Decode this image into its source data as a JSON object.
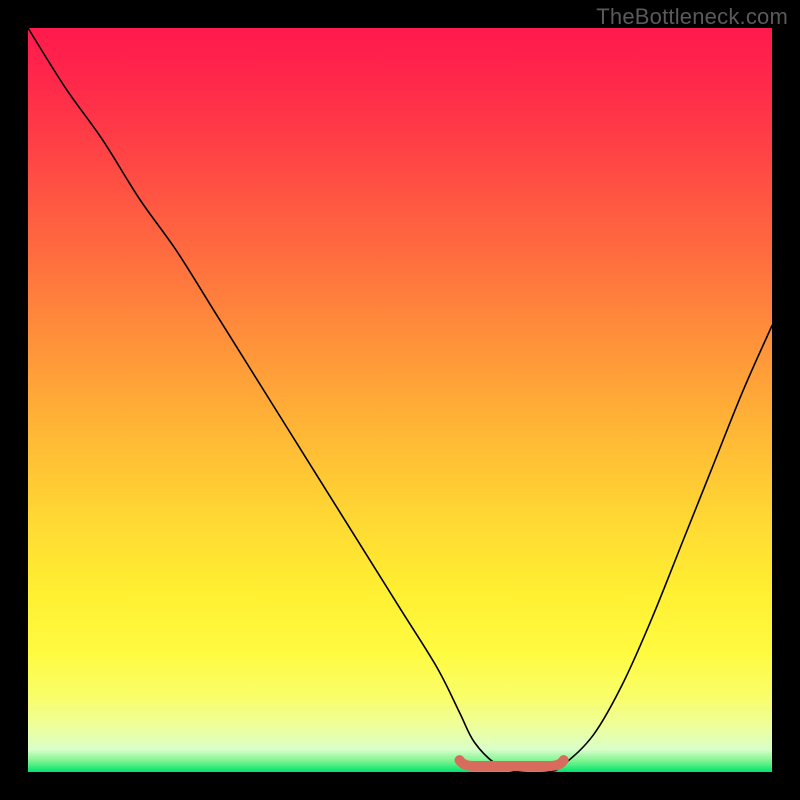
{
  "watermark": "TheBottleneck.com",
  "chart_data": {
    "type": "line",
    "title": "",
    "xlabel": "",
    "ylabel": "",
    "xlim": [
      0,
      100
    ],
    "ylim": [
      0,
      100
    ],
    "grid": false,
    "legend": false,
    "series": [
      {
        "name": "bottleneck-curve",
        "x": [
          0,
          5,
          10,
          15,
          20,
          25,
          30,
          35,
          40,
          45,
          50,
          55,
          58,
          60,
          63,
          66,
          70,
          72,
          76,
          80,
          84,
          88,
          92,
          96,
          100
        ],
        "y": [
          100,
          92,
          85,
          77,
          70,
          62,
          54,
          46,
          38,
          30,
          22,
          14,
          8,
          4,
          1,
          0,
          0,
          1,
          5,
          12,
          21,
          31,
          41,
          51,
          60
        ]
      }
    ],
    "flat_region": {
      "x_start": 60,
      "x_end": 72,
      "y": 0.5
    },
    "marker": {
      "name": "optimal-range",
      "color": "#d96b5e",
      "thickness": 10,
      "x_start": 58,
      "x_end": 72,
      "y": 0.8
    },
    "background_gradient": {
      "orientation": "vertical",
      "stops": [
        {
          "pos": 0.0,
          "color": "#ff1a4d"
        },
        {
          "pos": 0.3,
          "color": "#ff6b3f"
        },
        {
          "pos": 0.66,
          "color": "#ffd833"
        },
        {
          "pos": 0.9,
          "color": "#edff9b"
        },
        {
          "pos": 1.0,
          "color": "#00e36b"
        }
      ]
    }
  }
}
